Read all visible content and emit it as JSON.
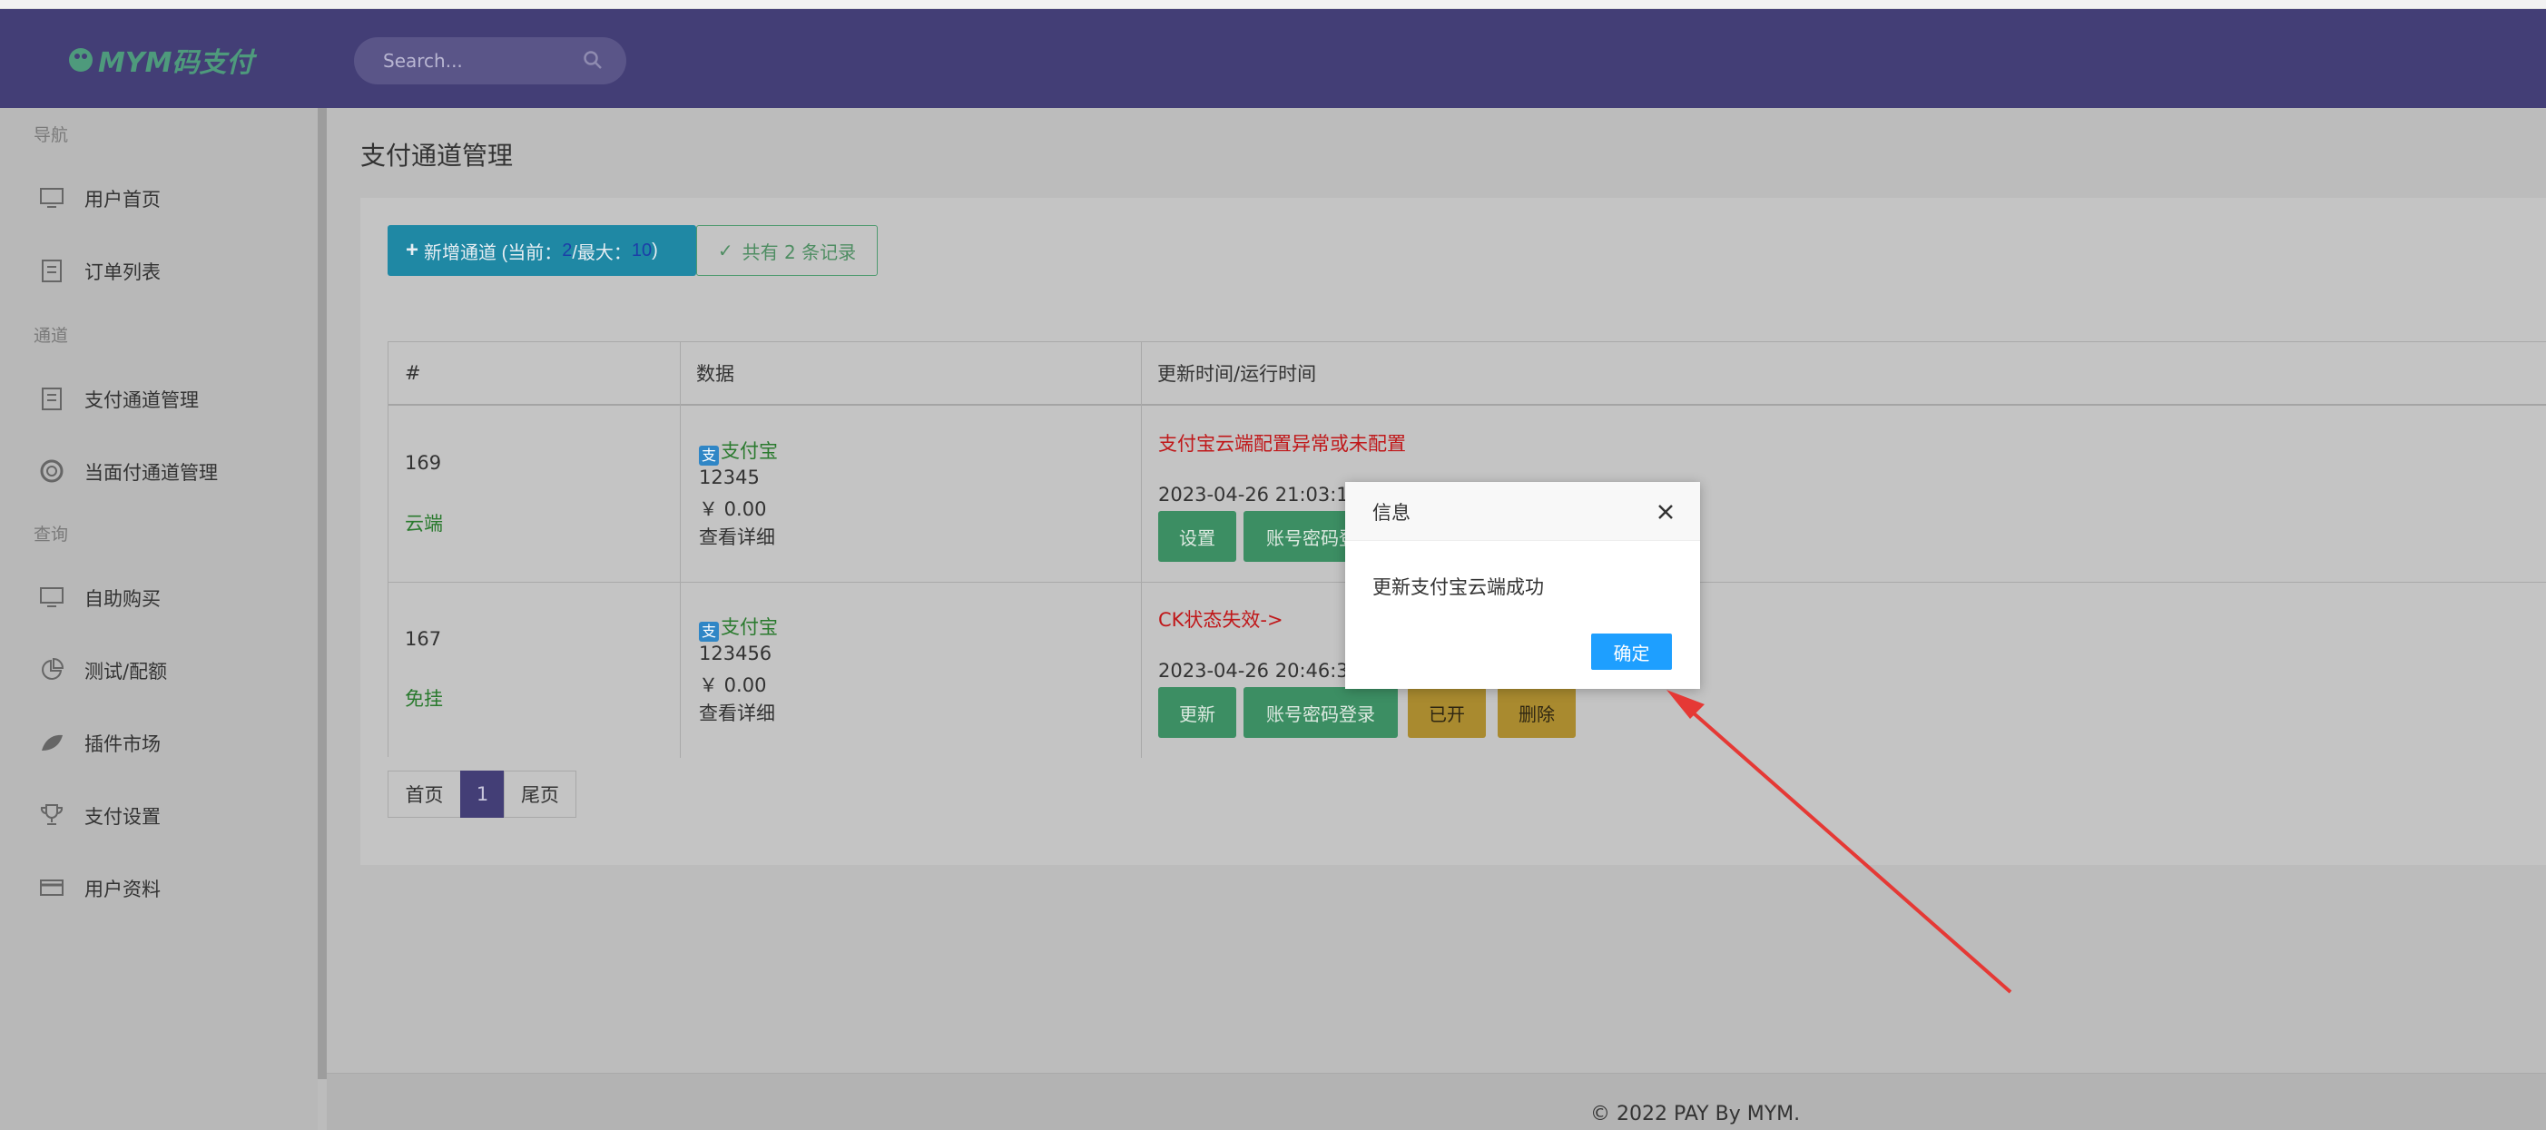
{
  "header": {
    "logo_text": "MYM码支付",
    "search_placeholder": "Search..."
  },
  "sidebar": {
    "groups": [
      {
        "label": "导航",
        "items": [
          {
            "label": "用户首页",
            "icon": "monitor-icon"
          },
          {
            "label": "订单列表",
            "icon": "clipboard-icon"
          }
        ]
      },
      {
        "label": "通道",
        "items": [
          {
            "label": "支付通道管理",
            "icon": "clipboard-icon"
          },
          {
            "label": "当面付通道管理",
            "icon": "lifebuoy-icon"
          }
        ]
      },
      {
        "label": "查询",
        "items": [
          {
            "label": "自助购买",
            "icon": "monitor-icon"
          },
          {
            "label": "测试/配额",
            "icon": "pie-chart-icon"
          },
          {
            "label": "插件市场",
            "icon": "leaf-icon"
          },
          {
            "label": "支付设置",
            "icon": "trophy-icon"
          },
          {
            "label": "用户资料",
            "icon": "card-icon"
          }
        ]
      }
    ]
  },
  "main": {
    "title": "支付通道管理",
    "add_button": {
      "prefix": "新增通道 (当前：",
      "current": "2",
      "mid": "/最大：",
      "max": "10",
      "suffix": ")"
    },
    "count_label": "共有 2 条记录",
    "table": {
      "headers": [
        "#",
        "数据",
        "更新时间/运行时间"
      ],
      "rows": [
        {
          "id": "169",
          "type": "云端",
          "channel": "支付宝",
          "account": "12345",
          "amount": "￥ 0.00",
          "detail": "查看详细",
          "status": "支付宝云端配置异常或未配置",
          "time": "2023-04-26 21:03:11",
          "buttons": [
            "设置",
            "账号密码登录"
          ]
        },
        {
          "id": "167",
          "type": "免挂",
          "channel": "支付宝",
          "account": "123456",
          "amount": "￥ 0.00",
          "detail": "查看详细",
          "status": "CK状态失效->",
          "time": "2023-04-26 20:46:33",
          "buttons": [
            "更新",
            "账号密码登录",
            "已开",
            "删除"
          ]
        }
      ]
    },
    "pager": {
      "first": "首页",
      "current": "1",
      "last": "尾页"
    }
  },
  "footer": {
    "text": "© 2022 PAY By MYM."
  },
  "modal": {
    "title": "信息",
    "message": "更新支付宝云端成功",
    "ok_label": "确定"
  },
  "colors": {
    "header": "#433e76",
    "green_button": "#3c8e63",
    "yellow_button": "#a98a2f",
    "modal_ok": "#1e9fff",
    "annotation_arrow": "#e53935"
  }
}
